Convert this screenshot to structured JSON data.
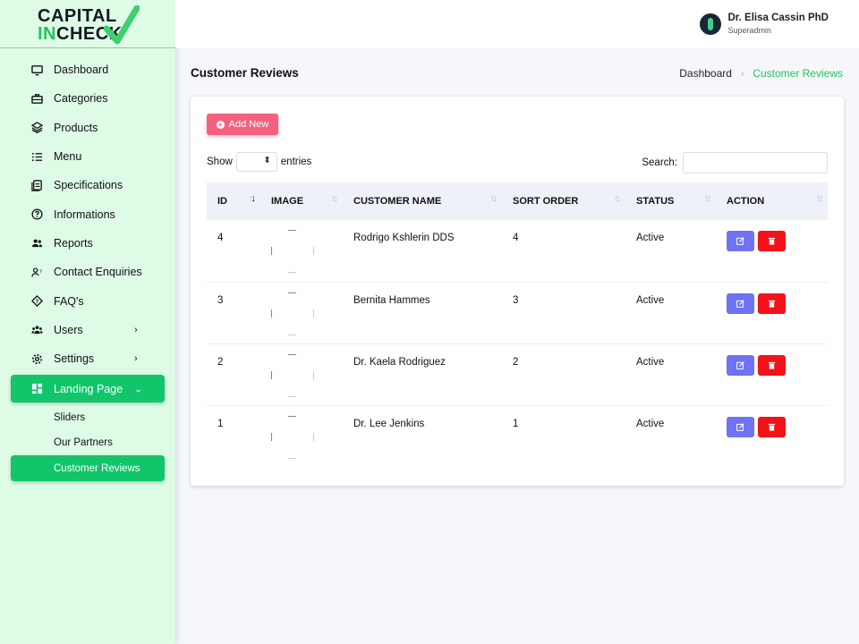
{
  "brand": {
    "line1": "CAPITAL",
    "line2_in": "IN",
    "line2_rest": "CHECK"
  },
  "user": {
    "name": "Dr. Elisa Cassin PhD",
    "role": "Superadmin"
  },
  "sidebar": {
    "items": [
      {
        "label": "Dashboard",
        "icon": "monitor-icon"
      },
      {
        "label": "Categories",
        "icon": "briefcase-icon"
      },
      {
        "label": "Products",
        "icon": "layers-icon"
      },
      {
        "label": "Menu",
        "icon": "list-icon"
      },
      {
        "label": "Specifications",
        "icon": "document-icon"
      },
      {
        "label": "Informations",
        "icon": "question-circle-icon"
      },
      {
        "label": "Reports",
        "icon": "users-icon"
      },
      {
        "label": "Contact Enquiries",
        "icon": "user-question-icon"
      },
      {
        "label": "FAQ's",
        "icon": "diamond-question-icon"
      },
      {
        "label": "Users",
        "icon": "group-icon"
      },
      {
        "label": "Settings",
        "icon": "gear-icon"
      },
      {
        "label": "Landing Page",
        "icon": "dashboard-grid-icon"
      }
    ],
    "sub_items": [
      {
        "label": "Sliders"
      },
      {
        "label": "Our Partners"
      },
      {
        "label": "Customer Reviews"
      }
    ]
  },
  "page": {
    "title": "Customer Reviews"
  },
  "breadcrumb": {
    "home": "Dashboard",
    "current": "Customer Reviews"
  },
  "toolbar": {
    "add_label": "Add New",
    "show_label": "Show",
    "entries_label": "entries",
    "search_label": "Search:",
    "search_value": ""
  },
  "table": {
    "columns": [
      "ID",
      "IMAGE",
      "CUSTOMER NAME",
      "SORT ORDER",
      "STATUS",
      "ACTION"
    ],
    "rows": [
      {
        "id": "4",
        "name": "Rodrigo Kshlerin DDS",
        "sort_order": "4",
        "status": "Active"
      },
      {
        "id": "3",
        "name": "Bernita Hammes",
        "sort_order": "3",
        "status": "Active"
      },
      {
        "id": "2",
        "name": "Dr. Kaela Rodriguez",
        "sort_order": "2",
        "status": "Active"
      },
      {
        "id": "1",
        "name": "Dr. Lee Jenkins",
        "sort_order": "1",
        "status": "Active"
      }
    ]
  },
  "colors": {
    "accent": "#10c56a",
    "add_button": "#f4617f",
    "edit": "#6f72f2",
    "delete": "#f3121a"
  }
}
